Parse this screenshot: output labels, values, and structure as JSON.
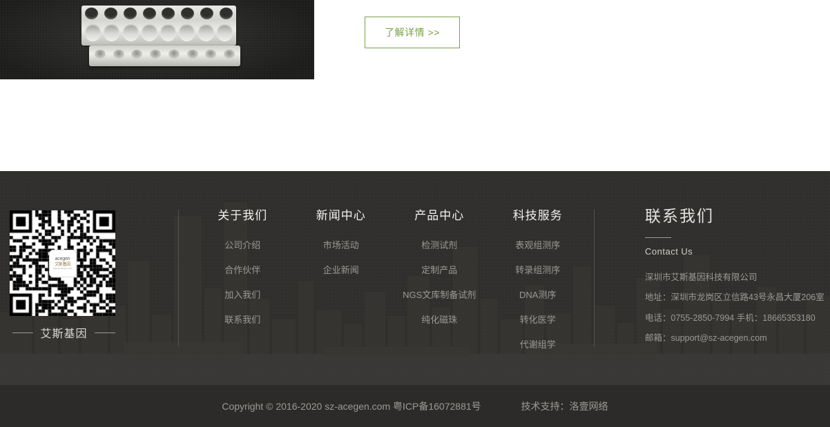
{
  "hero": {
    "product_image_alt": "pcr-8-tube-strip-photo",
    "cta_label": "了解详情 >>",
    "cta_border_color": "#7ba049",
    "cta_text_color": "#7ba049"
  },
  "footer": {
    "background_color": "#302f2d",
    "brand_name": "艾斯基因",
    "qr_logo": {
      "en": "acegen",
      "cn": "艾斯基因",
      "url": "www.sz-acegen.com"
    },
    "columns": [
      {
        "title": "关于我们",
        "links": [
          "公司介绍",
          "合作伙伴",
          "加入我们",
          "联系我们"
        ]
      },
      {
        "title": "新闻中心",
        "links": [
          "市场活动",
          "企业新闻"
        ]
      },
      {
        "title": "产品中心",
        "links": [
          "检测试剂",
          "定制产品",
          "NGS文库制备试剂",
          "纯化磁珠"
        ]
      },
      {
        "title": "科技服务",
        "links": [
          "表观组测序",
          "转录组测序",
          "DNA测序",
          "转化医学",
          "代谢组学"
        ]
      }
    ],
    "contact": {
      "title": "联系我们",
      "subtitle": "Contact Us",
      "company": "深圳市艾斯基因科技有限公司",
      "address": "地址：深圳市龙岗区立信路43号永昌大厦206室",
      "phone": "电话：0755-2850-7994 手机：18665353180",
      "email": "邮箱：support@sz-acegen.com"
    }
  },
  "copyright": {
    "text": "Copyright © 2016-2020 sz-acegen.com 粤ICP备16072881号",
    "support": "技术支持：洛壹网络"
  }
}
